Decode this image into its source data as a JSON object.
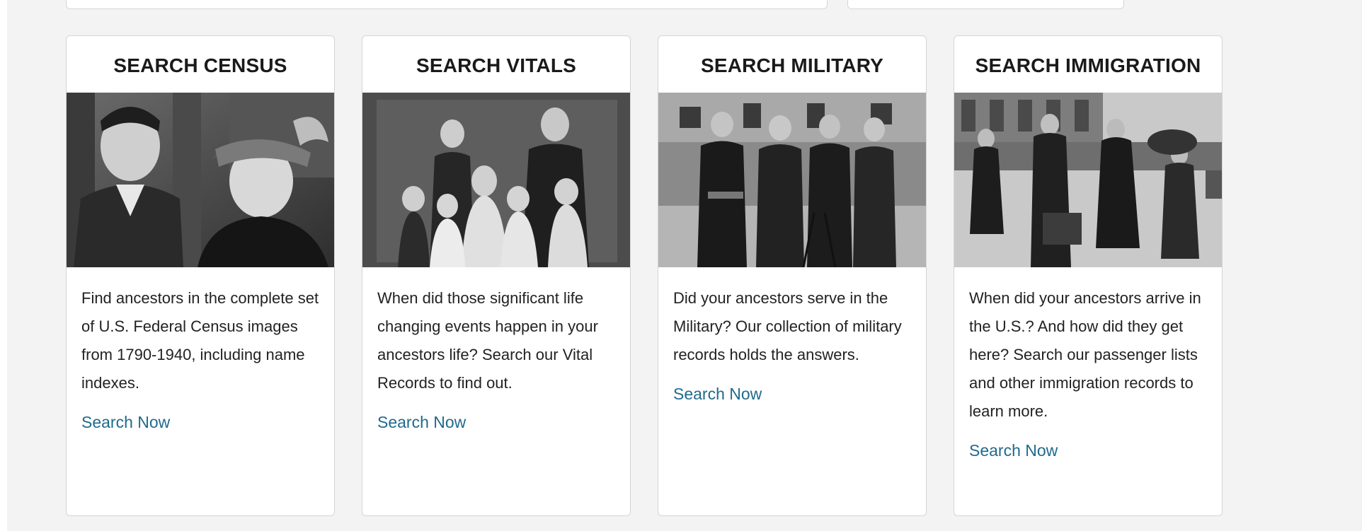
{
  "cards": [
    {
      "title": "SEARCH CENSUS",
      "image_alt": "Vintage photo of a man in a suit and a smiling woman in a fur hat",
      "description": "Find ancestors in the complete set of U.S. Federal Census images from 1790-1940, including name indexes.",
      "link": "Search Now"
    },
    {
      "title": "SEARCH VITALS",
      "image_alt": "Vintage family portrait with parents and children",
      "description": "When did those significant life changing events happen in your ancestors life? Search our Vital Records to find out.",
      "link": "Search Now"
    },
    {
      "title": "SEARCH MILITARY",
      "image_alt": "Vintage photo of uniformed military officers",
      "description": "Did your ancestors serve in the Military? Our collection of military records holds the answers.",
      "link": "Search Now"
    },
    {
      "title": "SEARCH IMMIGRATION",
      "image_alt": "Vintage photo of immigrants carrying luggage",
      "description": "When did your ancestors arrive in the U.S.? And how did they get here? Search our passenger lists and other immigration records to learn more.",
      "link": "Search Now"
    }
  ],
  "colors": {
    "panel_bg": "#f3f3f3",
    "card_border": "#d4d4d4",
    "link": "#1f6a8d",
    "text": "#222222"
  }
}
